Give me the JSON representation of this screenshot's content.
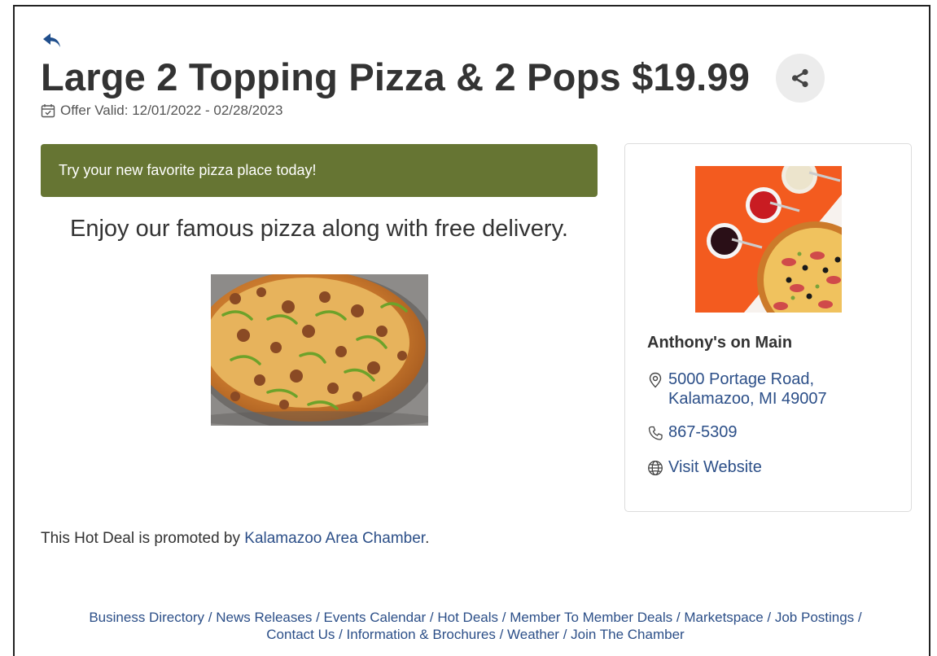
{
  "deal": {
    "title": "Large 2 Topping Pizza & 2 Pops $19.99",
    "validity": "Offer Valid: 12/01/2022 - 02/28/2023",
    "banner_text": "Try your new favorite pizza place today!",
    "lead_text": "Enjoy our famous pizza along with free delivery."
  },
  "icons": {
    "back": "back-arrow-icon",
    "share": "share-icon",
    "calendar": "calendar-check-icon",
    "location": "map-pin-icon",
    "phone": "phone-icon",
    "website": "globe-icon"
  },
  "business": {
    "name": "Anthony's on Main",
    "address": "5000 Portage Road, Kalamazoo, MI 49007",
    "phone": "867-5309",
    "website_label": "Visit Website"
  },
  "promoted": {
    "prefix": "This Hot Deal is promoted by ",
    "link": "Kalamazoo Area Chamber",
    "suffix": "."
  },
  "footer_links": [
    "Business Directory",
    "News Releases",
    "Events Calendar",
    "Hot Deals",
    "Member To Member Deals",
    "Marketspace",
    "Job Postings",
    "Contact Us",
    "Information & Brochures",
    "Weather",
    "Join The Chamber"
  ],
  "colors": {
    "banner": "#667533",
    "link": "#2c4f88",
    "text": "#333333"
  }
}
